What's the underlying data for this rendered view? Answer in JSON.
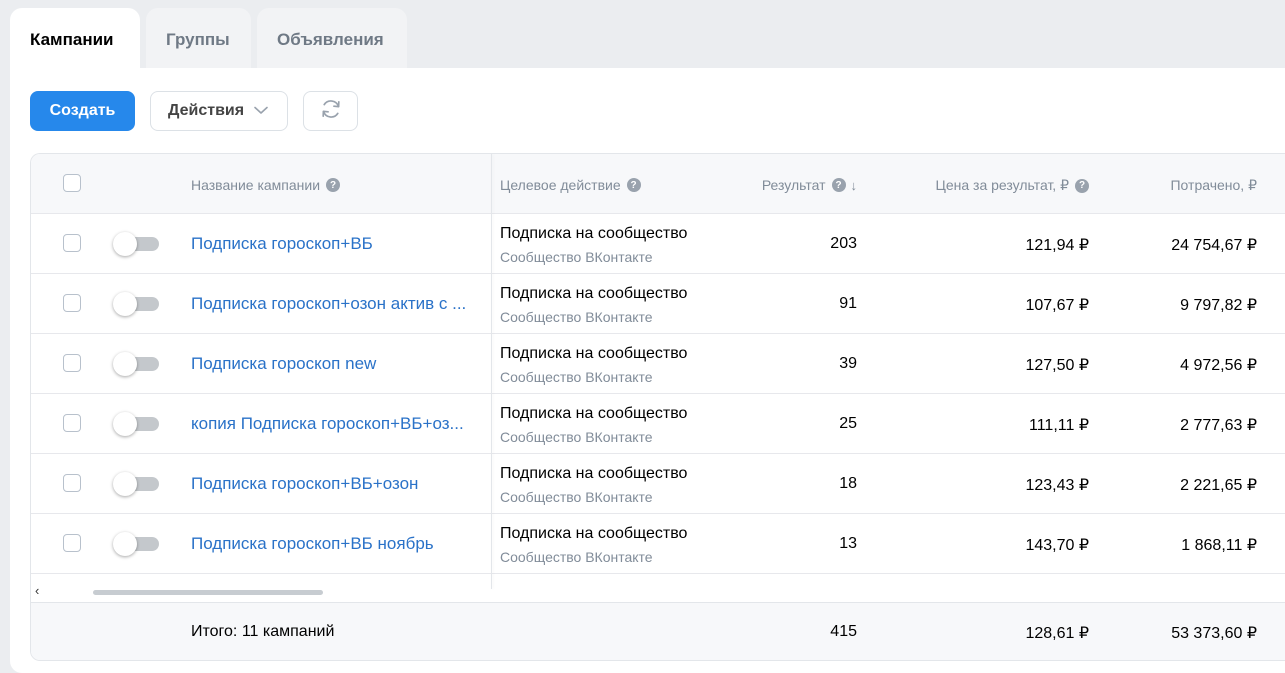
{
  "tabs": [
    {
      "label": "Кампании",
      "active": true
    },
    {
      "label": "Группы",
      "active": false
    },
    {
      "label": "Объявления",
      "active": false
    }
  ],
  "toolbar": {
    "create_label": "Создать",
    "actions_label": "Действия"
  },
  "columns": {
    "name": "Название кампании",
    "target": "Целевое действие",
    "result": "Результат",
    "price": "Цена за результат, ₽",
    "spent": "Потрачено, ₽"
  },
  "rows": [
    {
      "name": "Подписка гороскоп+ВБ",
      "target": "Подписка на сообщество",
      "target_sub": "Сообщество ВКонтакте",
      "result": "203",
      "price": "121,94 ₽",
      "spent": "24 754,67 ₽"
    },
    {
      "name": "Подписка гороскоп+озон актив с ...",
      "target": "Подписка на сообщество",
      "target_sub": "Сообщество ВКонтакте",
      "result": "91",
      "price": "107,67 ₽",
      "spent": "9 797,82 ₽"
    },
    {
      "name": "Подписка гороскоп new",
      "target": "Подписка на сообщество",
      "target_sub": "Сообщество ВКонтакте",
      "result": "39",
      "price": "127,50 ₽",
      "spent": "4 972,56 ₽"
    },
    {
      "name": "копия Подписка гороскоп+ВБ+оз...",
      "target": "Подписка на сообщество",
      "target_sub": "Сообщество ВКонтакте",
      "result": "25",
      "price": "111,11 ₽",
      "spent": "2 777,63 ₽"
    },
    {
      "name": "Подписка гороскоп+ВБ+озон",
      "target": "Подписка на сообщество",
      "target_sub": "Сообщество ВКонтакте",
      "result": "18",
      "price": "123,43 ₽",
      "spent": "2 221,65 ₽"
    },
    {
      "name": "Подписка гороскоп+ВБ ноябрь",
      "target": "Подписка на сообщество",
      "target_sub": "Сообщество ВКонтакте",
      "result": "13",
      "price": "143,70 ₽",
      "spent": "1 868,11 ₽"
    }
  ],
  "totals": {
    "label": "Итого: 11 кампаний",
    "result": "415",
    "price": "128,61 ₽",
    "spent": "53 373,60 ₽"
  },
  "icons": {
    "help": "question-circle-icon",
    "sort": "arrow-down-icon",
    "refresh": "refresh-icon",
    "dropdown": "chevron-down-icon"
  },
  "colors": {
    "primary": "#2688eb",
    "link": "#2a72c8",
    "muted": "#818c99"
  }
}
